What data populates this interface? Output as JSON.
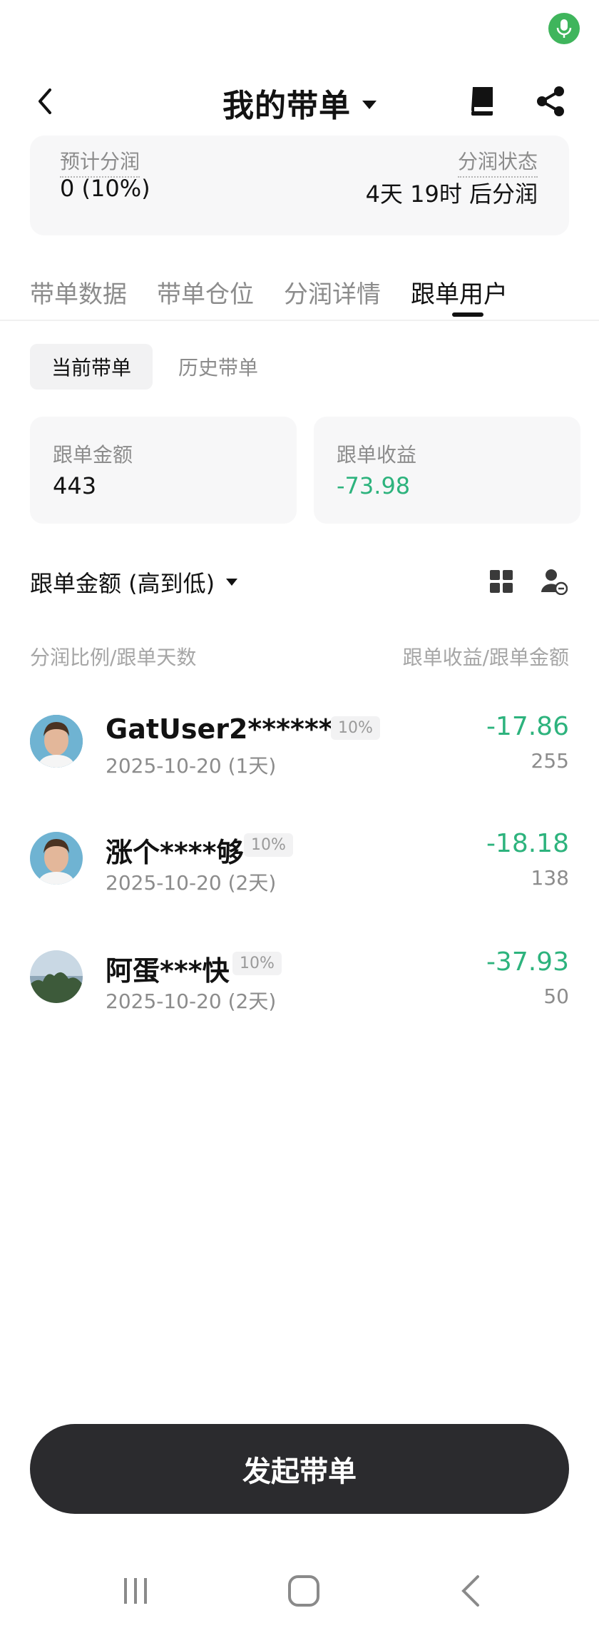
{
  "status": {
    "mic_color": "#3fb55c"
  },
  "header": {
    "title": "我的带单"
  },
  "summary": {
    "left_label": "预计分润",
    "left_value": "0 (10%)",
    "right_label": "分润状态",
    "right_value": "4天 19时 后分润"
  },
  "tabs": [
    "带单数据",
    "带单仓位",
    "分润详情",
    "跟单用户"
  ],
  "active_tab": "跟单用户",
  "subtabs": {
    "current": "当前带单",
    "history": "历史带单"
  },
  "stats": {
    "amount_label": "跟单金额",
    "amount_value": "443",
    "profit_label": "跟单收益",
    "profit_value": "-73.98"
  },
  "sort": {
    "label": "跟单金额 (高到低)"
  },
  "columns": {
    "left": "分润比例/跟单天数",
    "right": "跟单收益/跟单金额"
  },
  "users": [
    {
      "name": "GatUser2******b",
      "pct": "10%",
      "date": "2025-10-20 (1天)",
      "profit": "-17.86",
      "amount": "255",
      "avatar": "face"
    },
    {
      "name": "涨个****够",
      "pct": "10%",
      "date": "2025-10-20 (2天)",
      "profit": "-18.18",
      "amount": "138",
      "avatar": "face"
    },
    {
      "name": "阿蛋***快",
      "pct": "10%",
      "date": "2025-10-20 (2天)",
      "profit": "-37.93",
      "amount": "50",
      "avatar": "landscape"
    }
  ],
  "cta": {
    "label": "发起带单"
  },
  "colors": {
    "profit_negative": "#2db37d",
    "button_dark": "#2b2b2e"
  }
}
